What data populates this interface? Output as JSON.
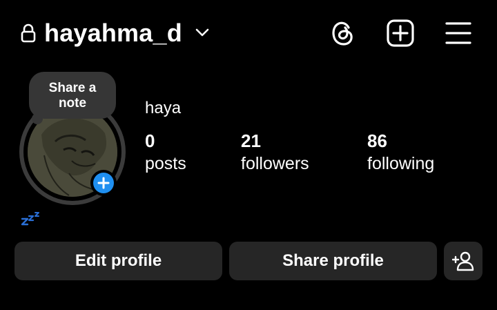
{
  "header": {
    "username": "hayahma_d",
    "icons": {
      "lock": "lock-icon",
      "chevron": "chevron-down-icon",
      "threads": "threads-icon",
      "create": "plus-square-icon",
      "menu": "hamburger-menu-icon"
    }
  },
  "note": {
    "label": "Share a note"
  },
  "avatar": {
    "add_story_icon": "plus-icon",
    "status_icon": "zzz-icon"
  },
  "profile": {
    "display_name": "haya",
    "stats": [
      {
        "value": "0",
        "label": "posts"
      },
      {
        "value": "21",
        "label": "followers"
      },
      {
        "value": "86",
        "label": "following"
      }
    ]
  },
  "actions": {
    "edit_label": "Edit profile",
    "share_label": "Share profile",
    "discover_icon": "add-person-icon"
  },
  "colors": {
    "background": "#000000",
    "button": "#262626",
    "bubble": "#363636",
    "accent_blue": "#1f8ff0",
    "text": "#ffffff"
  }
}
